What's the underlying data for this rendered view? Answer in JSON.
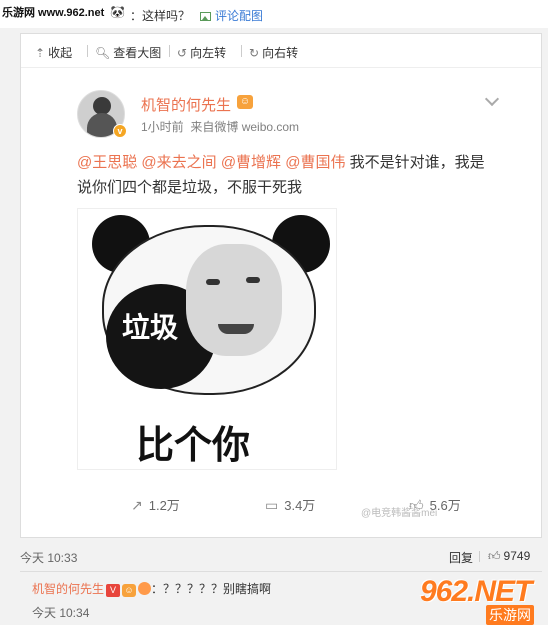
{
  "top": {
    "watermark": "乐游网 www.962.net",
    "emoji": "🐼",
    "text": "：这样吗？",
    "comment_image_link": "评论配图"
  },
  "toolbar": {
    "collapse": "收起",
    "view_large": "查看大图",
    "rotate_left": "向左转",
    "rotate_right": "向右转"
  },
  "post": {
    "username": "机智的何先生",
    "time": "1小时前",
    "source": "来自微博 weibo.com",
    "mentions": [
      "@王思聪",
      "@来去之间",
      "@曹增辉",
      "@曹国伟"
    ],
    "text": " 我不是针对谁，我是说你们四个都是垃圾，不服干死我",
    "image": {
      "label_top": "垃圾",
      "label_bottom": "比个你"
    },
    "actions": {
      "forward": "1.2万",
      "comment": "3.4万",
      "like": "5.6万"
    },
    "image_watermark": "@电竞韩酱酱mei"
  },
  "comment": {
    "time": "今天 10:33",
    "reply": "回复",
    "likes": "9749"
  },
  "reply": {
    "name": "机智的何先生",
    "text": "：？？？？？别瞎搞啊",
    "time": "今天 10:34"
  },
  "site_logo": {
    "main": "962.NET",
    "sub": "乐游网"
  },
  "colors": {
    "accent": "#eb7350",
    "link": "#3a7bd5",
    "logo": "#ff7b1f"
  }
}
